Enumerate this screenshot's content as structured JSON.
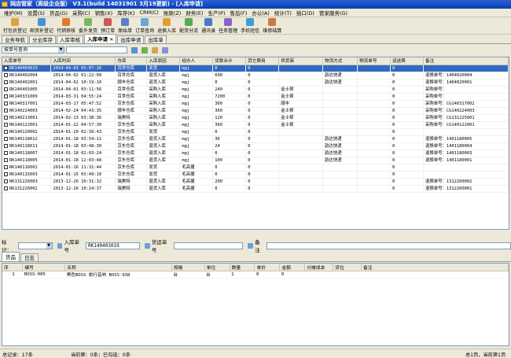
{
  "window": {
    "title": "网店管家（高级企业版） V3.1(build 14031901 3月19更新) - [入库申请]"
  },
  "menu": [
    "维护(M)",
    "设置(S)",
    "货品(G)",
    "采购(C)",
    "销售(X)",
    "库存(K)",
    "CRM(C)",
    "账款(Z)",
    "财务(E)",
    "生产(P)",
    "售后(F)",
    "办公(A)",
    "统计(T)",
    "插口(D)",
    "管家服务(G)"
  ],
  "toolbar": [
    {
      "label": "打包员登记",
      "color": "#d9a441"
    },
    {
      "label": "邮资补登记",
      "color": "#4a8fd9"
    },
    {
      "label": "代销审核",
      "color": "#e07a2e"
    },
    {
      "label": "委外发货",
      "color": "#7bb661"
    },
    {
      "label": "预订单",
      "color": "#c95b5b"
    },
    {
      "label": "原始单",
      "color": "#5b7fc9"
    },
    {
      "label": "订单查询",
      "color": "#6aa6d6"
    },
    {
      "label": "退换入库",
      "color": "#e0a030"
    },
    {
      "label": "配货分流",
      "color": "#58a858"
    },
    {
      "label": "通讯录",
      "color": "#4a79c9"
    },
    {
      "label": "任务管理",
      "color": "#8a63c9"
    },
    {
      "label": "手机短信",
      "color": "#3a9fd0"
    },
    {
      "label": "维修结算",
      "color": "#c97a3a"
    }
  ],
  "tabs": [
    {
      "label": "业务导航",
      "active": false
    },
    {
      "label": "分全库存",
      "active": false
    },
    {
      "label": "入库审核",
      "active": false
    },
    {
      "label": "入库申请",
      "active": true
    },
    {
      "label": "出库申请",
      "active": false
    },
    {
      "label": "出库单",
      "active": false
    }
  ],
  "query": {
    "mode": "按单号查询",
    "value": ""
  },
  "grid": {
    "columns": [
      "入库单号",
      "入库时间",
      "仓库",
      "入库原因",
      "经办人",
      "货款合计",
      "其它费用",
      "供货商",
      "物流方式",
      "物流单号",
      "运送费",
      "备注"
    ],
    "rows": [
      [
        "RK140403019",
        "2014-04-03 05:07:26",
        "百世仓库",
        "发货",
        "mgj",
        "0",
        "0",
        "",
        "",
        "",
        "0",
        ""
      ],
      [
        "RK140402004",
        "2014-04-02 01:22:09",
        "百世仓库",
        "退货入库",
        "mgj",
        "690",
        "0",
        "",
        "韵达快递",
        "",
        "0",
        "退换单号：1404020004"
      ],
      [
        "RK140402001",
        "2014-04-02 10:19:10",
        "顺丰仓库",
        "退货入库",
        "mgj",
        "0",
        "0",
        "",
        "韵达快递",
        "",
        "0",
        "退换单号：1404020001"
      ],
      [
        "RK140401005",
        "2014-04-01 03:11:56",
        "百世仓库",
        "采购入库",
        "mgj",
        "240",
        "0",
        "金士顿",
        "",
        "",
        "0",
        "采购单号："
      ],
      [
        "RK140331009",
        "2014-03-31 04:55:24",
        "百世仓库",
        "采购入库",
        "mgj",
        "7200",
        "0",
        "金士顿",
        "",
        "",
        "0",
        "采购单号："
      ],
      [
        "RK140317001",
        "2014-03-17 05:47:52",
        "京东仓库",
        "采购入库",
        "mgj",
        "360",
        "0",
        "顺丰",
        "",
        "",
        "0",
        "采购单号：CG140317002"
      ],
      [
        "RK140224003",
        "2014-02-24 04:43:35",
        "顺丰仓库",
        "采购入库",
        "mgj",
        "360",
        "0",
        "金士顿",
        "",
        "",
        "0",
        "采购单号：CG140224003"
      ],
      [
        "RK140213001",
        "2014-02-13 03:38:36",
        "瑞美特",
        "采购入库",
        "mgj",
        "120",
        "0",
        "金士顿",
        "",
        "",
        "0",
        "采购单号：CG131225001"
      ],
      [
        "RK140122001",
        "2014-01-22 04:57:30",
        "京东仓库",
        "采购入库",
        "mgj",
        "360",
        "0",
        "金士顿",
        "",
        "",
        "0",
        "采购单号：CG140122001"
      ],
      [
        "RK140120002",
        "2014-01-20 02:39:43",
        "京东仓库",
        "发货",
        "mgj",
        "0",
        "0",
        "",
        "",
        "",
        "0",
        ""
      ],
      [
        "RK140118012",
        "2014-01-18 03:54:11",
        "京东仓库",
        "退货入库",
        "mgj",
        "36",
        "0",
        "",
        "韵达快递",
        "",
        "0",
        "退换单号：1401180005"
      ],
      [
        "RK140118011",
        "2014-01-18 03:48:30",
        "京东仓库",
        "退货入库",
        "mgj",
        "24",
        "0",
        "",
        "韵达快递",
        "",
        "0",
        "退换单号：1401180004"
      ],
      [
        "RK140118007",
        "2014-01-18 02:03:24",
        "京东仓库",
        "退货入库",
        "mgj",
        "0",
        "0",
        "",
        "韵达快递",
        "",
        "0",
        "退换单号：1401180003"
      ],
      [
        "RK140118005",
        "2014-01-18 12:03:48",
        "京东仓库",
        "退货入库",
        "mgj",
        "100",
        "0",
        "",
        "韵达快递",
        "",
        "0",
        "退换单号：1401180001"
      ],
      [
        "RK140116002",
        "2014-01-16 11:31:44",
        "京东仓库",
        "发货",
        "毛高捷",
        "0",
        "0",
        "",
        "",
        "",
        "0",
        ""
      ],
      [
        "RK140115003",
        "2014-01-15 03:49:10",
        "京东仓库",
        "发货",
        "毛高捷",
        "0",
        "0",
        "",
        "",
        "",
        "0",
        ""
      ],
      [
        "RK131226003",
        "2013-12-26 10:31:32",
        "瑞美特",
        "退货入库",
        "毛高捷",
        "200",
        "0",
        "",
        "",
        "",
        "0",
        "退换单号：1312260002"
      ],
      [
        "RK131226002",
        "2013-12-26 10:24:37",
        "瑞美特",
        "退货入库",
        "毛高捷",
        "0",
        "0",
        "",
        "",
        "",
        "0",
        "退换单号：1312260001"
      ]
    ]
  },
  "detail": {
    "mark_label": "标记：",
    "inbound_no_label": "入库单号",
    "inbound_no": "RK140403019",
    "return_no_label": "货运单号",
    "return_no": "",
    "note_label": "备注",
    "note": ""
  },
  "subtabs": [
    {
      "label": "货品",
      "active": true
    },
    {
      "label": "日志",
      "active": false
    }
  ],
  "items": {
    "columns": [
      "序",
      "编号",
      "名称",
      "规格",
      "单位",
      "数量",
      "单价",
      "金额",
      "分摊成本",
      "货位",
      "备注"
    ],
    "rows": [
      [
        "1",
        "BOSS-005",
        "黑色BOSS 旅行音响 BOSS-938",
        "台",
        "台",
        "1",
        "0",
        "0",
        "",
        "",
        ""
      ]
    ]
  },
  "status": {
    "total": "总记录：17条",
    "current": "当前第：0条；已勾选：0条",
    "pages": "总1页，当前第1页"
  }
}
